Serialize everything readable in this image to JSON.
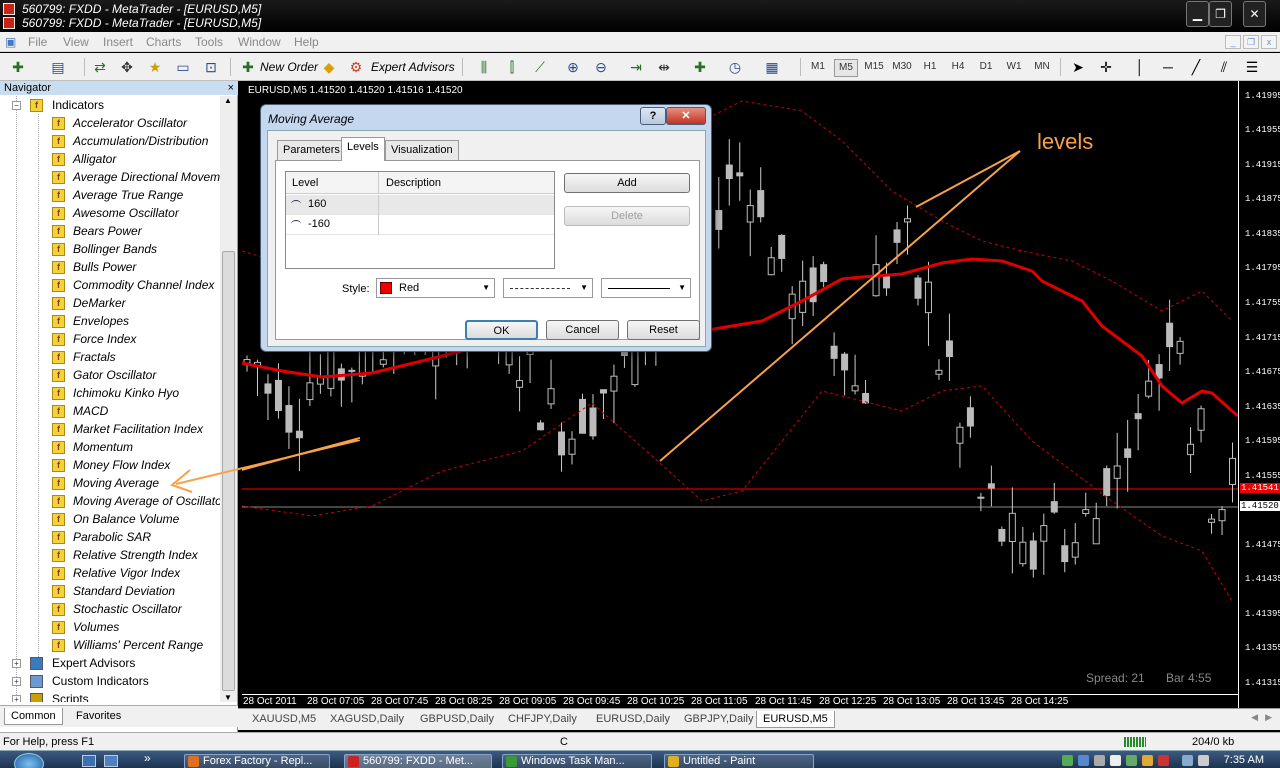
{
  "window": {
    "title_line1": "560799: FXDD - MetaTrader - [EURUSD,M5]",
    "title_line2": "560799: FXDD - MetaTrader - [EURUSD,M5]"
  },
  "menu": [
    "File",
    "View",
    "Insert",
    "Charts",
    "Tools",
    "Window",
    "Help"
  ],
  "toolbar": {
    "new_order": "New Order",
    "expert_advisors": "Expert Advisors",
    "timeframes": [
      "M1",
      "M5",
      "M15",
      "M30",
      "H1",
      "H4",
      "D1",
      "W1",
      "MN"
    ],
    "selected_timeframe": "M5"
  },
  "navigator": {
    "title": "Navigator",
    "close": "×",
    "root": "Indicators",
    "indicators": [
      "Accelerator Oscillator",
      "Accumulation/Distribution",
      "Alligator",
      "Average Directional Movem",
      "Average True Range",
      "Awesome Oscillator",
      "Bears Power",
      "Bollinger Bands",
      "Bulls Power",
      "Commodity Channel Index",
      "DeMarker",
      "Envelopes",
      "Force Index",
      "Fractals",
      "Gator Oscillator",
      "Ichimoku Kinko Hyo",
      "MACD",
      "Market Facilitation Index",
      "Momentum",
      "Money Flow Index",
      "Moving Average",
      "Moving Average of Oscillato",
      "On Balance Volume",
      "Parabolic SAR",
      "Relative Strength Index",
      "Relative Vigor Index",
      "Standard Deviation",
      "Stochastic Oscillator",
      "Volumes",
      "Williams' Percent Range"
    ],
    "groups": [
      "Expert Advisors",
      "Custom Indicators",
      "Scripts"
    ],
    "tabs": [
      "Common",
      "Favorites"
    ]
  },
  "chart": {
    "info": "EURUSD,M5  1.41520 1.41520 1.41516 1.41520",
    "annotation": "levels",
    "spread": "Spread: 21",
    "bar_time": "Bar 4:55",
    "prices": [
      "1.41995",
      "1.41955",
      "1.41915",
      "1.41875",
      "1.41835",
      "1.41795",
      "1.41755",
      "1.41715",
      "1.41675",
      "1.41635",
      "1.41595",
      "1.41555",
      "1.41541",
      "1.41520",
      "1.41475",
      "1.41435",
      "1.41395",
      "1.41355",
      "1.41315"
    ],
    "times": [
      "28 Oct 2011",
      "28 Oct 07:05",
      "28 Oct 07:45",
      "28 Oct 08:25",
      "28 Oct 09:05",
      "28 Oct 09:45",
      "28 Oct 10:25",
      "28 Oct 11:05",
      "28 Oct 11:45",
      "28 Oct 12:25",
      "28 Oct 13:05",
      "28 Oct 13:45",
      "28 Oct 14:25"
    ],
    "tabs": [
      "XAUUSD,M5",
      "XAGUSD,Daily",
      "GBPUSD,Daily",
      "CHFJPY,Daily",
      "EURUSD,Daily",
      "GBPJPY,Daily",
      "EURUSD,M5"
    ],
    "active_tab": "EURUSD,M5",
    "colors": {
      "ma": "#e00000",
      "bands": "#cc0000",
      "level_line": "#ff0000",
      "annotation": "#f7a14a"
    }
  },
  "dialog": {
    "title": "Moving Average",
    "help": "?",
    "close": "✕",
    "tabs": [
      "Parameters",
      "Levels",
      "Visualization"
    ],
    "active_tab": "Levels",
    "columns": [
      "Level",
      "Description"
    ],
    "levels": [
      {
        "level": "160",
        "description": ""
      },
      {
        "level": "-160",
        "description": ""
      }
    ],
    "add": "Add",
    "delete": "Delete",
    "style_label": "Style:",
    "color": "Red",
    "ok": "OK",
    "cancel": "Cancel",
    "reset": "Reset"
  },
  "status": {
    "help": "For Help, press F1",
    "c": "C",
    "traffic": "204/0 kb"
  },
  "taskbar": {
    "items": [
      "Forex Factory - Repl...",
      "560799: FXDD - Met...",
      "Windows Task Man...",
      "Untitled - Paint"
    ],
    "clock": "7:35 AM"
  }
}
